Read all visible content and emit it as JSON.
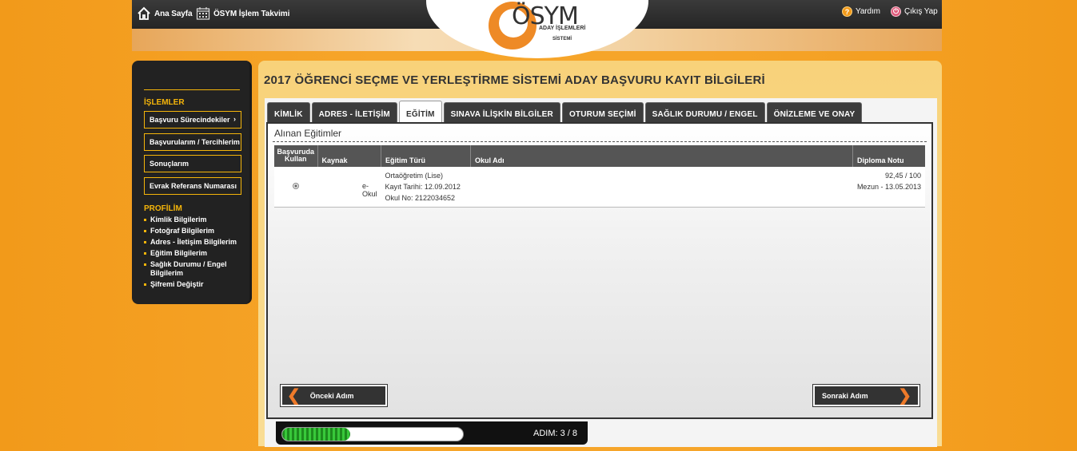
{
  "topbar": {
    "home_label": "Ana Sayfa",
    "calendar_label": "ÖSYM İşlem Takvimi",
    "help_label": "Yardım",
    "exit_label": "Çıkış Yap"
  },
  "logo": {
    "name": "ÖSYM",
    "line1": "ADAY İŞLEMLERİ",
    "line2": "SİSTEMİ"
  },
  "sidebar": {
    "section1_title": "İŞLEMLER",
    "buttons": [
      {
        "label": "Başvuru Sürecindekiler",
        "arrow": "›"
      },
      {
        "label": "Başvurularım / Tercihlerim"
      },
      {
        "label": "Sonuçlarım"
      },
      {
        "label": "Evrak Referans Numarası"
      }
    ],
    "section2_title": "PROFİLİM",
    "links": [
      "Kimlik Bilgilerim",
      "Fotoğraf Bilgilerim",
      "Adres - İletişim Bilgilerim",
      "Eğitim Bilgilerim",
      "Sağlık Durumu / Engel Bilgilerim",
      "Şifremi Değiştir"
    ]
  },
  "main": {
    "title": "2017 ÖĞRENCİ SEÇME VE YERLEŞTİRME SİSTEMİ ADAY BAŞVURU KAYIT BİLGİLERİ",
    "tabs": [
      {
        "label": "KİMLİK",
        "active": false
      },
      {
        "label": "ADRES - İLETİŞİM",
        "active": false
      },
      {
        "label": "EĞİTİM",
        "active": true
      },
      {
        "label": "SINAVA İLİŞKİN BİLGİLER",
        "active": false
      },
      {
        "label": "OTURUM SEÇİMİ",
        "active": false
      },
      {
        "label": "SAĞLIK DURUMU / ENGEL",
        "active": false
      },
      {
        "label": "ÖNİZLEME VE ONAY",
        "active": false
      }
    ],
    "section_title": "Alınan Eğitimler",
    "table": {
      "headers": [
        "Başvuruda Kullan",
        "Kaynak",
        "Eğitim Türü",
        "Okul Adı",
        "Diploma Notu"
      ],
      "rows": [
        {
          "source": "e-Okul",
          "type": "Ortaöğretim (Lise)",
          "reg_date": "Kayıt Tarihi: 12.09.2012",
          "school_no": "Okul No: 2122034652",
          "school_name": "",
          "grade": "92,45 / 100",
          "graduation": "Mezun - 13.05.2013"
        }
      ]
    },
    "prev_label": "Önceki Adım",
    "next_label": "Sonraki Adım"
  },
  "step": {
    "label": "ADIM:  3 / 8",
    "current": 3,
    "total": 8
  }
}
